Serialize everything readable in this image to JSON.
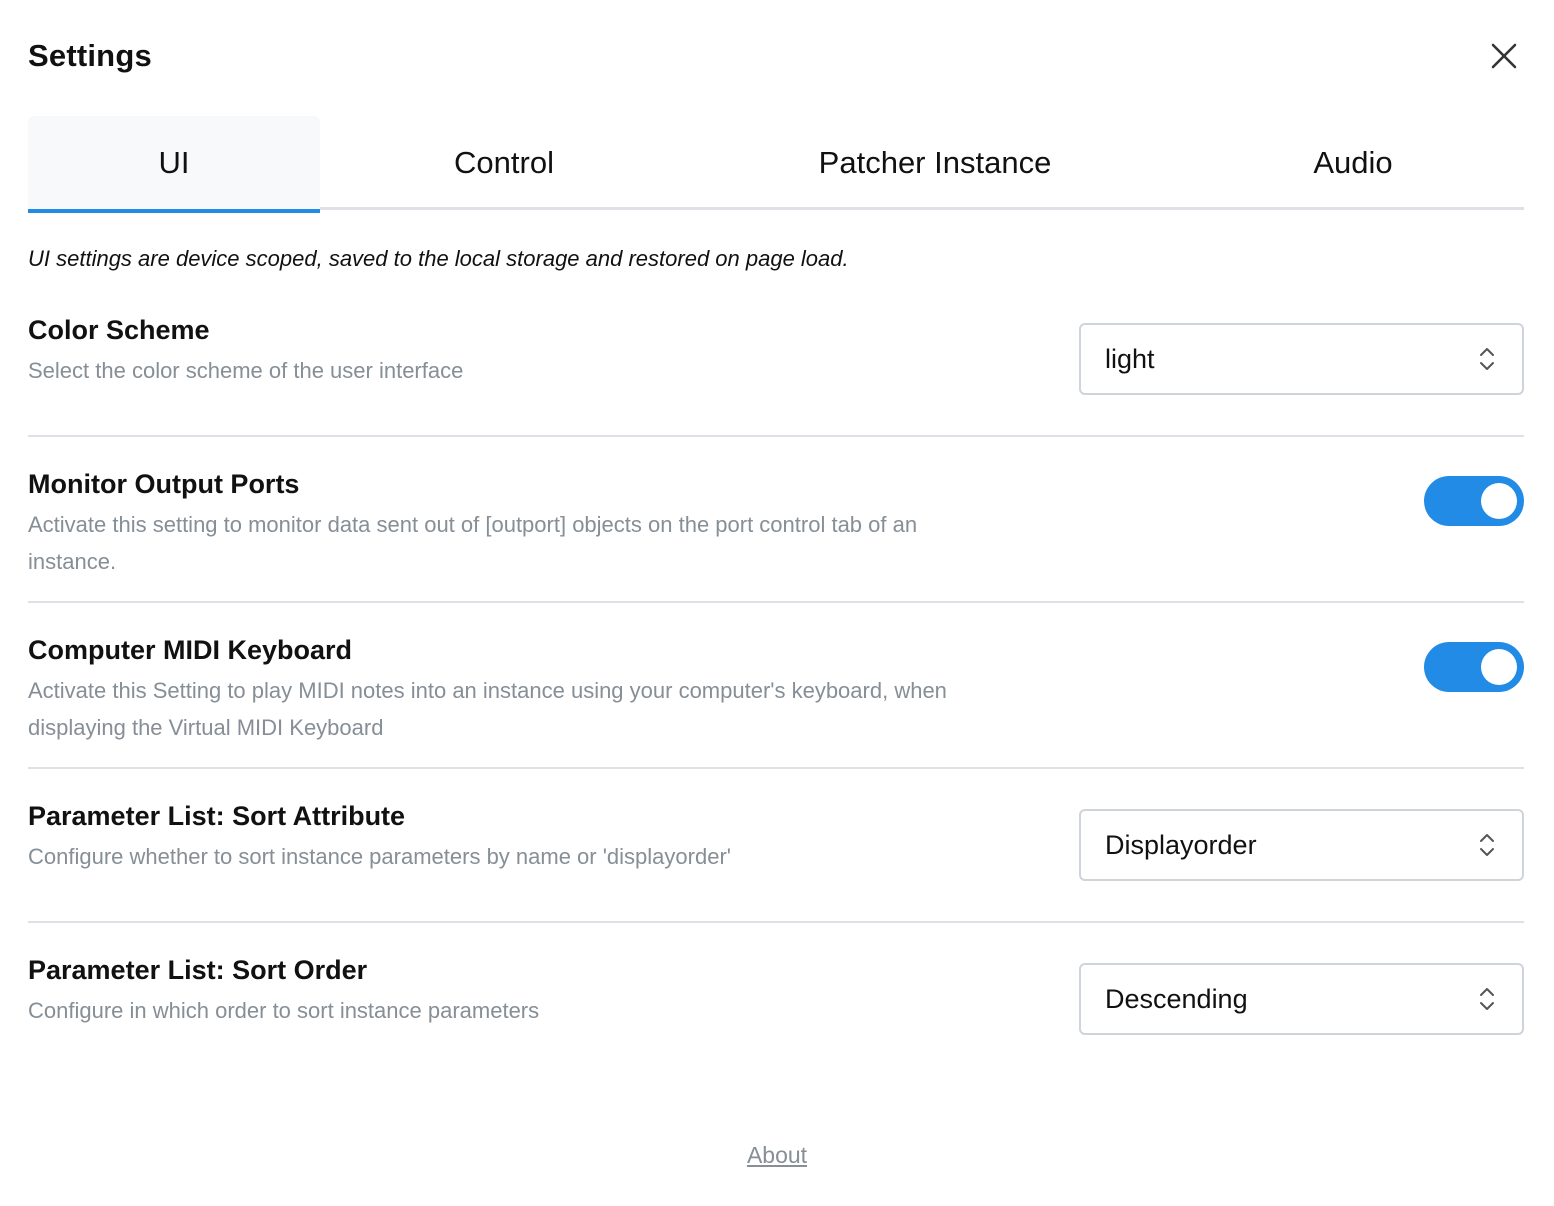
{
  "dialog": {
    "title": "Settings"
  },
  "tabs": [
    {
      "label": "UI",
      "active": true
    },
    {
      "label": "Control",
      "active": false
    },
    {
      "label": "Patcher Instance",
      "active": false
    },
    {
      "label": "Audio",
      "active": false
    }
  ],
  "intro": "UI settings are device scoped, saved to the local storage and restored on page load.",
  "settings": {
    "color_scheme": {
      "title": "Color Scheme",
      "description": "Select the color scheme of the user interface",
      "value": "light"
    },
    "monitor_output_ports": {
      "title": "Monitor Output Ports",
      "description": "Activate this setting to monitor data sent out of [outport] objects on the port control tab of an instance.",
      "enabled": true
    },
    "computer_midi_keyboard": {
      "title": "Computer MIDI Keyboard",
      "description": "Activate this Setting to play MIDI notes into an instance using your computer's keyboard, when displaying the Virtual MIDI Keyboard",
      "enabled": true
    },
    "sort_attribute": {
      "title": "Parameter List: Sort Attribute",
      "description": "Configure whether to sort instance parameters by name or 'displayorder'",
      "value": "Displayorder"
    },
    "sort_order": {
      "title": "Parameter List: Sort Order",
      "description": "Configure in which order to sort instance parameters",
      "value": "Descending"
    }
  },
  "footer": {
    "about_label": "About"
  },
  "colors": {
    "accent": "#228be6",
    "muted_text": "#868e96",
    "border": "#dee2e6"
  }
}
